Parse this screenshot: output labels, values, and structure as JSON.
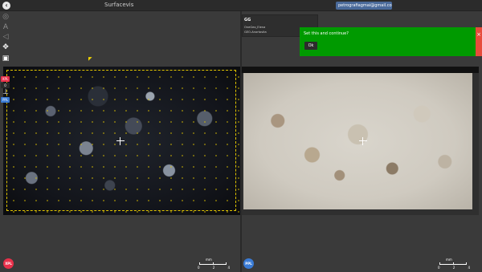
{
  "app": {
    "title": "Surfacevis",
    "back_icon": "back-arrow-icon"
  },
  "user": {
    "email": "petrografiagmai@gmail.com ▾"
  },
  "toolbar": {
    "tools": [
      {
        "name": "target-icon",
        "glyph": "◎"
      },
      {
        "name": "text-icon",
        "glyph": "A"
      },
      {
        "name": "sound-icon",
        "glyph": "◁"
      },
      {
        "name": "move-icon",
        "glyph": "✥"
      },
      {
        "name": "image-icon",
        "glyph": "▣"
      }
    ]
  },
  "left_viewer": {
    "top_tag": "XPL",
    "mid_tag": "0",
    "bottom_tag": "PPL",
    "mode_badge": "XPL",
    "mode_color": "#e8304a"
  },
  "right_viewer": {
    "mode_badge": "PPL",
    "mode_color": "#3a7bd5"
  },
  "scale": {
    "unit": "mm",
    "ticks": [
      "0",
      "2",
      "4"
    ]
  },
  "info": {
    "title": "GG",
    "line1": "OneGeo_Elena",
    "line2": "GEO-Anortosita"
  },
  "dialog": {
    "message": "Set this and continue?",
    "ok_label": "Ok",
    "close_label": "×",
    "bg_color": "#009a00"
  }
}
